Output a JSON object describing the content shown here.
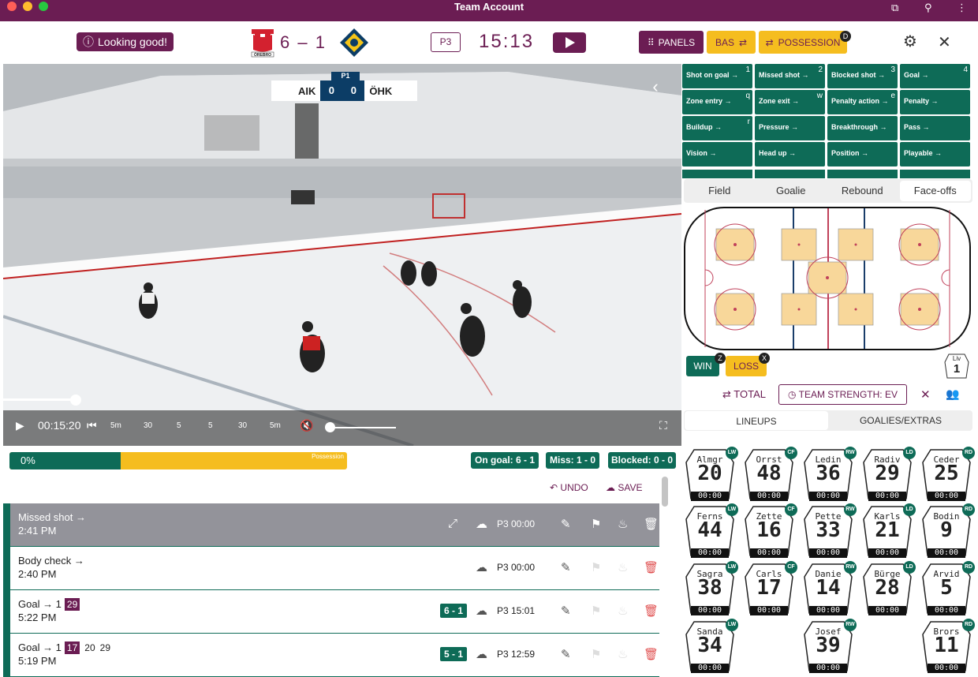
{
  "window": {
    "title": "Team Account"
  },
  "header": {
    "status": "Looking good!",
    "score_home": "6",
    "score_sep": "–",
    "score_away": "1",
    "period": "P3",
    "clock": "15:13",
    "panels_label": "PANELS",
    "bas_label": "BAS",
    "possession_label": "POSSESSION",
    "possession_key": "D",
    "home_logo_text": "ÖREBRO"
  },
  "video": {
    "overlay": {
      "team1": "AIK",
      "score1": "0",
      "score2": "0",
      "team2": "ÖHK",
      "period": "P1"
    },
    "time": "00:15:20",
    "skip_labels": [
      "5m",
      "30",
      "5",
      "5",
      "30",
      "5m"
    ],
    "progress_fraction": 0.107
  },
  "stats": {
    "possession_pct": "0%",
    "possession_label": "Possession",
    "possession_fill": 0.33,
    "on_goal": "On goal: 6 - 1",
    "miss": "Miss: 1 - 0",
    "blocked": "Blocked: 0 - 0"
  },
  "actions": {
    "undo": "UNDO",
    "save": "SAVE"
  },
  "events": [
    {
      "name": "Missed shot →",
      "time": "2:41 PM",
      "period": "P3 00:00",
      "selected": true
    },
    {
      "name": "Body check →",
      "time": "2:40 PM",
      "period": "P3 00:00"
    },
    {
      "name": "Goal → 1",
      "tag": "29",
      "time": "5:22 PM",
      "score": "6 - 1",
      "period": "P3 15:01"
    },
    {
      "name": "Goal → 1",
      "tag": "17",
      "extra1": "20",
      "extra2": "29",
      "time": "5:19 PM",
      "score": "5 - 1",
      "period": "P3 12:59"
    }
  ],
  "shortcuts": [
    {
      "label": "Shot on goal →",
      "key": "1"
    },
    {
      "label": "Missed shot →",
      "key": "2"
    },
    {
      "label": "Blocked shot →",
      "key": "3"
    },
    {
      "label": "Goal →",
      "key": "4"
    },
    {
      "label": "Zone entry →",
      "key": "q"
    },
    {
      "label": "Zone exit →",
      "key": "w"
    },
    {
      "label": "Penalty action →",
      "key": "e"
    },
    {
      "label": "Penalty →",
      "key": ""
    },
    {
      "label": "Buildup →",
      "key": "r"
    },
    {
      "label": "Pressure →",
      "key": ""
    },
    {
      "label": "Breakthrough →",
      "key": ""
    },
    {
      "label": "Pass →",
      "key": ""
    },
    {
      "label": "Vision →",
      "key": ""
    },
    {
      "label": "Head up →",
      "key": ""
    },
    {
      "label": "Position →",
      "key": ""
    },
    {
      "label": "Playable →",
      "key": ""
    }
  ],
  "field_tabs": [
    "Field",
    "Goalie",
    "Rebound",
    "Face-offs"
  ],
  "faceoff": {
    "win": "WIN",
    "win_key": "Z",
    "loss": "LOSS",
    "loss_key": "X",
    "liv_label": "Liv",
    "liv_num": "1"
  },
  "strength": {
    "total": "TOTAL",
    "team_strength": "TEAM STRENGTH: EV"
  },
  "lineup_tabs": [
    "LINEUPS",
    "GOALIES/EXTRAS"
  ],
  "players": [
    {
      "name": "Almgr",
      "num": "20",
      "pos": "LW",
      "time": "00:00"
    },
    {
      "name": "Orrst",
      "num": "48",
      "pos": "CF",
      "time": "00:00"
    },
    {
      "name": "Ledin",
      "num": "36",
      "pos": "RW",
      "time": "00:00"
    },
    {
      "name": "Radiv",
      "num": "29",
      "pos": "LD",
      "time": "00:00"
    },
    {
      "name": "Ceder",
      "num": "25",
      "pos": "RD",
      "time": "00:00"
    },
    {
      "name": "Ferns",
      "num": "44",
      "pos": "LW",
      "time": "00:00"
    },
    {
      "name": "Zette",
      "num": "16",
      "pos": "CF",
      "time": "00:00"
    },
    {
      "name": "Pette",
      "num": "33",
      "pos": "RW",
      "time": "00:00"
    },
    {
      "name": "Karls",
      "num": "21",
      "pos": "LD",
      "time": "00:00"
    },
    {
      "name": "Bodin",
      "num": "9",
      "pos": "RD",
      "time": "00:00"
    },
    {
      "name": "Sagra",
      "num": "38",
      "pos": "LW",
      "time": "00:00"
    },
    {
      "name": "Carls",
      "num": "17",
      "pos": "CF",
      "time": "00:00"
    },
    {
      "name": "Danie",
      "num": "14",
      "pos": "RW",
      "time": "00:00"
    },
    {
      "name": "Bürge",
      "num": "28",
      "pos": "LD",
      "time": "00:00"
    },
    {
      "name": "Arvid",
      "num": "5",
      "pos": "RD",
      "time": "00:00"
    },
    {
      "name": "Sanda",
      "num": "34",
      "pos": "LW",
      "time": "00:00"
    },
    {
      "name": "Josef",
      "num": "39",
      "pos": "RW",
      "time": "00:00"
    },
    {
      "name": "Brors",
      "num": "11",
      "pos": "RD",
      "time": "00:00"
    }
  ],
  "colors": {
    "brand": "#6b1d53",
    "green": "#0e6b57",
    "yellow": "#f5bd1f"
  }
}
